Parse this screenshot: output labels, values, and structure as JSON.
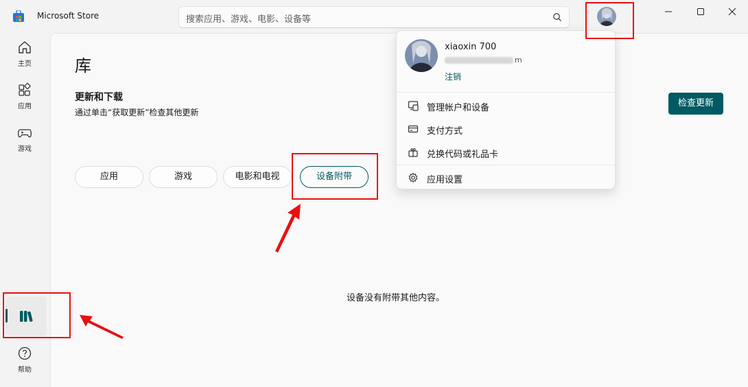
{
  "window": {
    "app_title": "Microsoft Store"
  },
  "search": {
    "placeholder": "搜索应用、游戏、电影、设备等"
  },
  "sidebar": {
    "items": [
      {
        "label": "主页",
        "icon": "home-icon"
      },
      {
        "label": "应用",
        "icon": "apps-icon"
      },
      {
        "label": "游戏",
        "icon": "game-controller-icon"
      },
      {
        "label": "",
        "icon": "library-icon"
      },
      {
        "label": "帮助",
        "icon": "help-icon"
      }
    ]
  },
  "page": {
    "title": "库",
    "section_title": "更新和下载",
    "section_subtitle": "通过单击“获取更新”检查其他更新",
    "check_updates_label": "检查更新",
    "filters": [
      "应用",
      "游戏",
      "电影和电视",
      "设备附带"
    ],
    "active_filter": "设备附带",
    "empty_message": "设备没有附带其他内容。"
  },
  "account_menu": {
    "username": "xiaoxin 700",
    "email_visible": "m",
    "sign_out": "注销",
    "items": [
      {
        "label": "管理帐户和设备",
        "icon": "account-devices-icon"
      },
      {
        "label": "支付方式",
        "icon": "credit-card-icon"
      },
      {
        "label": "兑换代码或礼品卡",
        "icon": "gift-card-icon"
      },
      {
        "label": "应用设置",
        "icon": "gear-icon"
      }
    ]
  },
  "colors": {
    "accent": "#005a61",
    "annotation": "#e81010"
  }
}
